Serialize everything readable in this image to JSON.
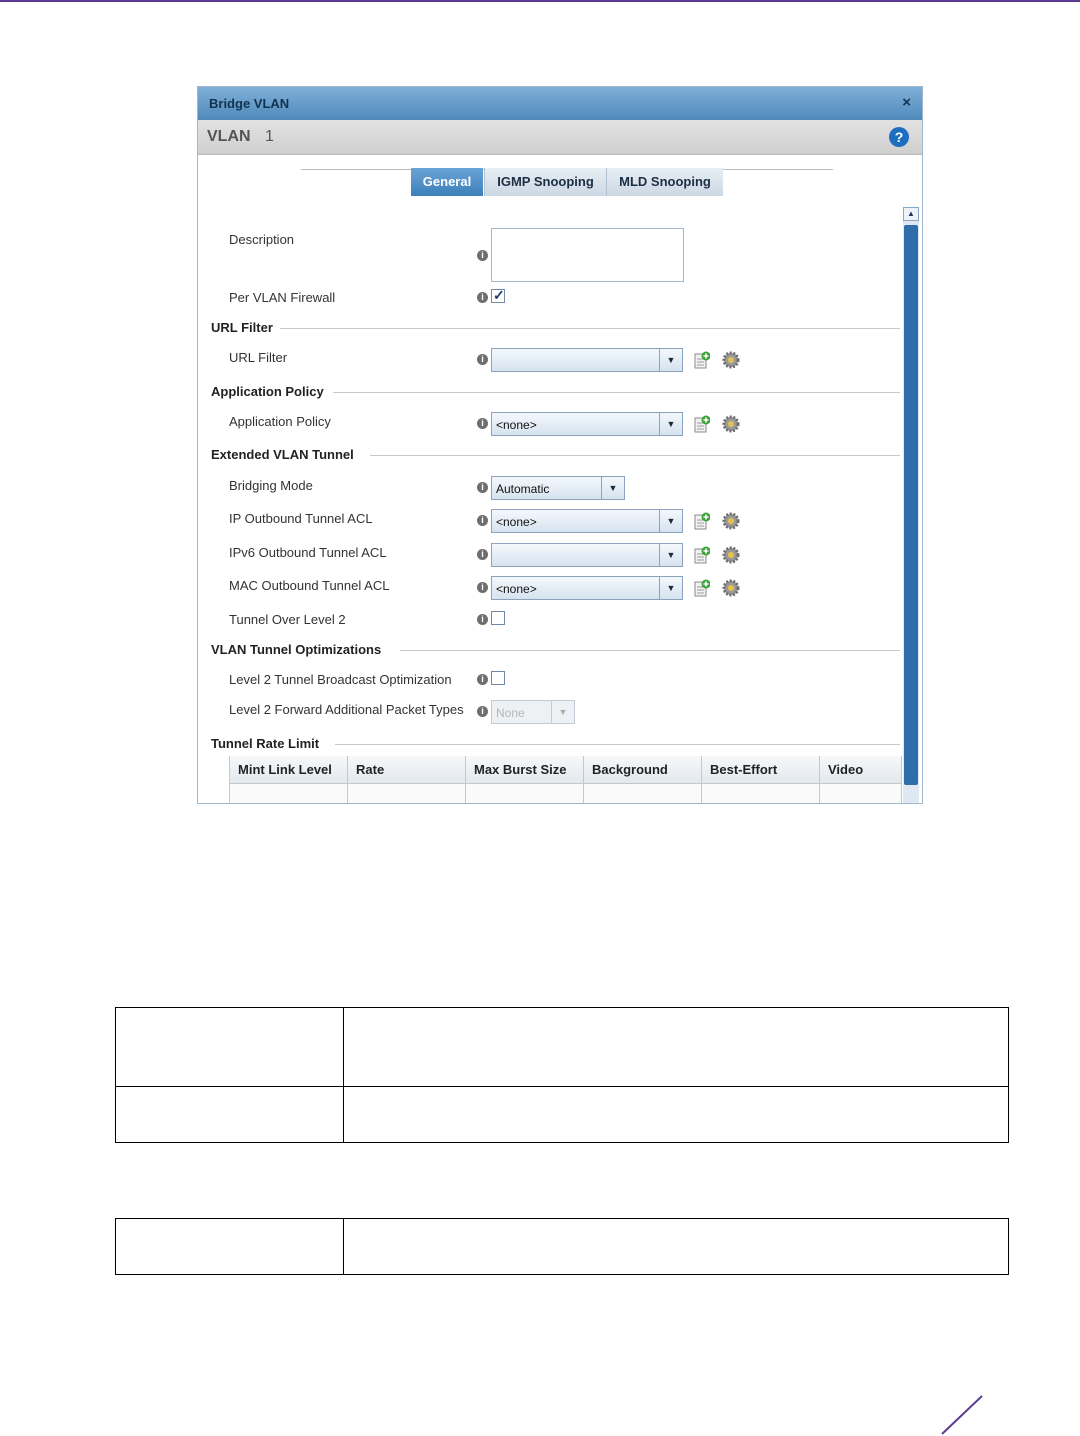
{
  "dialog": {
    "title": "Bridge VLAN",
    "close_label": "×",
    "vlan_label": "VLAN",
    "vlan_number": "1",
    "help_label": "?",
    "tabs": [
      {
        "label": "General",
        "active": true
      },
      {
        "label": "IGMP Snooping",
        "active": false
      },
      {
        "label": "MLD Snooping",
        "active": false
      }
    ],
    "fields": {
      "description_label": "Description",
      "description_value": "",
      "per_vlan_firewall_label": "Per VLAN Firewall",
      "per_vlan_firewall_checked": true
    },
    "url_filter": {
      "section_title": "URL Filter",
      "label": "URL Filter",
      "value": ""
    },
    "application_policy": {
      "section_title": "Application Policy",
      "label": "Application Policy",
      "value": "<none>"
    },
    "extended_vlan_tunnel": {
      "section_title": "Extended VLAN Tunnel",
      "bridging_mode_label": "Bridging Mode",
      "bridging_mode_value": "Automatic",
      "ip_outbound_label": "IP Outbound Tunnel ACL",
      "ip_outbound_value": "<none>",
      "ipv6_outbound_label": "IPv6 Outbound Tunnel ACL",
      "ipv6_outbound_value": "",
      "mac_outbound_label": "MAC Outbound Tunnel ACL",
      "mac_outbound_value": "<none>",
      "tunnel_over_l2_label": "Tunnel Over Level 2",
      "tunnel_over_l2_checked": false
    },
    "tunnel_optimizations": {
      "section_title": "VLAN Tunnel Optimizations",
      "broadcast_opt_label": "Level 2 Tunnel Broadcast Optimization",
      "broadcast_opt_checked": false,
      "forward_types_label": "Level 2 Forward Additional Packet Types",
      "forward_types_value": "None"
    },
    "tunnel_rate_limit": {
      "section_title": "Tunnel Rate Limit",
      "columns": [
        "Mint Link Level",
        "Rate",
        "Max Burst Size",
        "Background",
        "Best-Effort",
        "Video"
      ]
    }
  },
  "colors": {
    "accent": "#5b3a91",
    "title_bar": "#4f89bb",
    "active_tab": "#3d7fb9"
  },
  "icons": [
    "close-icon",
    "help-icon",
    "info-icon",
    "add-icon",
    "gear-icon",
    "dropdown-arrow-icon",
    "scroll-up-icon"
  ]
}
